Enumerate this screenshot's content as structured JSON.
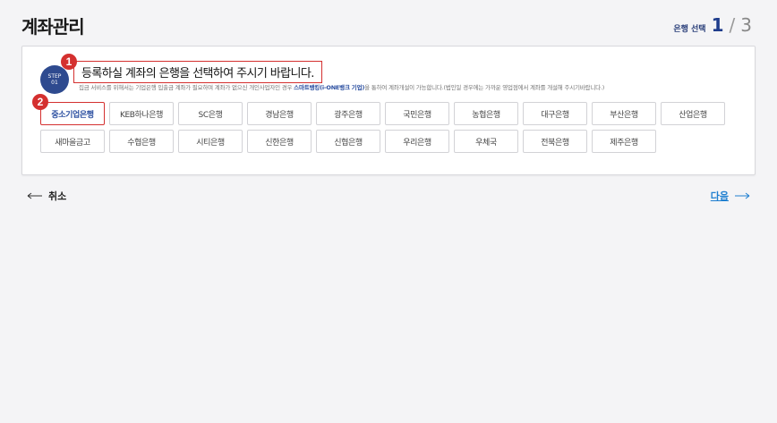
{
  "header": {
    "title": "계좌관리",
    "step_label": "은행 선택",
    "step_current": "1",
    "step_separator": "/",
    "step_total": "3"
  },
  "panel": {
    "badge_line1": "STEP",
    "badge_line2": "01",
    "heading": "등록하실 계좌의 은행을 선택하여 주시기 바랍니다.",
    "note_before": "집금 서비스를 위해서는 기업은행 입출금 계좌가 필요하며 계좌가 없으신 개인사업자인 경우 ",
    "note_link": "스마트뱅킹(i-ONE뱅크 기업)",
    "note_after": "을 통하여 계좌개설이 가능합니다.(법인일 경우에는 가까운 영업점에서 계좌를 개설해 주시기바랍니다.)",
    "callout_1": "1",
    "callout_2": "2"
  },
  "banks": [
    {
      "label": "중소기업은행",
      "selected": true
    },
    {
      "label": "KEB하나은행",
      "selected": false
    },
    {
      "label": "SC은행",
      "selected": false
    },
    {
      "label": "경남은행",
      "selected": false
    },
    {
      "label": "광주은행",
      "selected": false
    },
    {
      "label": "국민은행",
      "selected": false
    },
    {
      "label": "농협은행",
      "selected": false
    },
    {
      "label": "대구은행",
      "selected": false
    },
    {
      "label": "부산은행",
      "selected": false
    },
    {
      "label": "산업은행",
      "selected": false
    },
    {
      "label": "새마을금고",
      "selected": false
    },
    {
      "label": "수협은행",
      "selected": false
    },
    {
      "label": "시티은행",
      "selected": false
    },
    {
      "label": "신한은행",
      "selected": false
    },
    {
      "label": "신협은행",
      "selected": false
    },
    {
      "label": "우리은행",
      "selected": false
    },
    {
      "label": "우체국",
      "selected": false
    },
    {
      "label": "전북은행",
      "selected": false
    },
    {
      "label": "제주은행",
      "selected": false
    }
  ],
  "nav": {
    "cancel_label": "취소",
    "next_label": "다음",
    "cancel_icon": "arrow-left-icon",
    "next_icon": "arrow-right-icon"
  },
  "colors": {
    "accent": "#2e4a8f",
    "highlight": "#d4302f",
    "link": "#1f7fd0"
  }
}
